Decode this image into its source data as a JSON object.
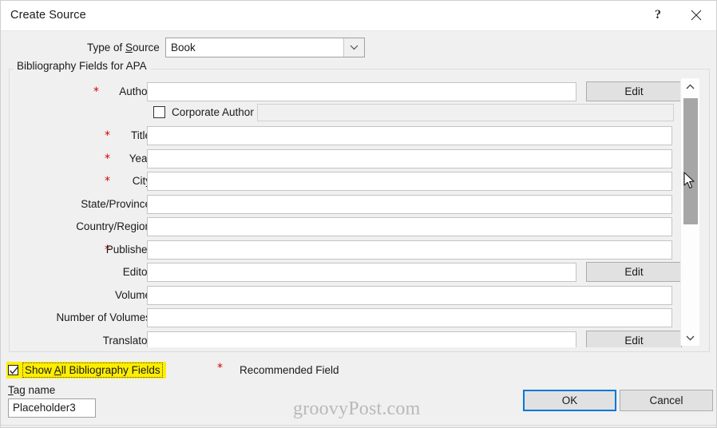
{
  "window": {
    "title": "Create Source",
    "help_icon": "question-mark-icon",
    "close_icon": "close-icon"
  },
  "type_of_source": {
    "label_pre": "Type of ",
    "label_accel": "S",
    "label_post": "ource",
    "value": "Book",
    "dropdown_icon": "chevron-down-icon"
  },
  "group": {
    "title": "Bibliography Fields for APA",
    "star": "*",
    "fields": [
      {
        "label": "Author",
        "required": true,
        "has_edit": true,
        "edit_label": "Edit",
        "value": ""
      },
      {
        "label": "Title",
        "required": true,
        "has_edit": false,
        "value": ""
      },
      {
        "label": "Year",
        "required": true,
        "has_edit": false,
        "value": ""
      },
      {
        "label": "City",
        "required": true,
        "has_edit": false,
        "value": ""
      },
      {
        "label": "State/Province",
        "required": false,
        "has_edit": false,
        "value": ""
      },
      {
        "label": "Country/Region",
        "required": false,
        "has_edit": false,
        "value": ""
      },
      {
        "label": "Publisher",
        "required": true,
        "has_edit": false,
        "value": ""
      },
      {
        "label": "Editor",
        "required": false,
        "has_edit": true,
        "edit_label": "Edit",
        "value": ""
      },
      {
        "label": "Volume",
        "required": false,
        "has_edit": false,
        "value": ""
      },
      {
        "label": "Number of Volumes",
        "required": false,
        "has_edit": false,
        "value": ""
      },
      {
        "label": "Translator",
        "required": false,
        "has_edit": true,
        "edit_label": "Edit",
        "value": ""
      }
    ],
    "corporate_author": {
      "label": "Corporate Author",
      "checked": false,
      "value": "",
      "enabled": false
    }
  },
  "scrollbar": {
    "up_icon": "chevron-up-icon",
    "down_icon": "chevron-down-icon",
    "thumb": "scroll-thumb"
  },
  "footer": {
    "show_all": {
      "label_pre": "Show ",
      "label_accel": "A",
      "label_post": "ll Bibliography Fields",
      "checked": true,
      "highlight_color": "#ffee00"
    },
    "recommended": {
      "star": "*",
      "label": "Recommended Field",
      "star_color": "#d40000"
    },
    "tag_name": {
      "label_accel": "T",
      "label_post": "ag name",
      "value": "Placeholder3"
    },
    "watermark": "groovyPost.com",
    "ok_label": "OK",
    "cancel_label": "Cancel",
    "focus_color": "#0078d7"
  }
}
